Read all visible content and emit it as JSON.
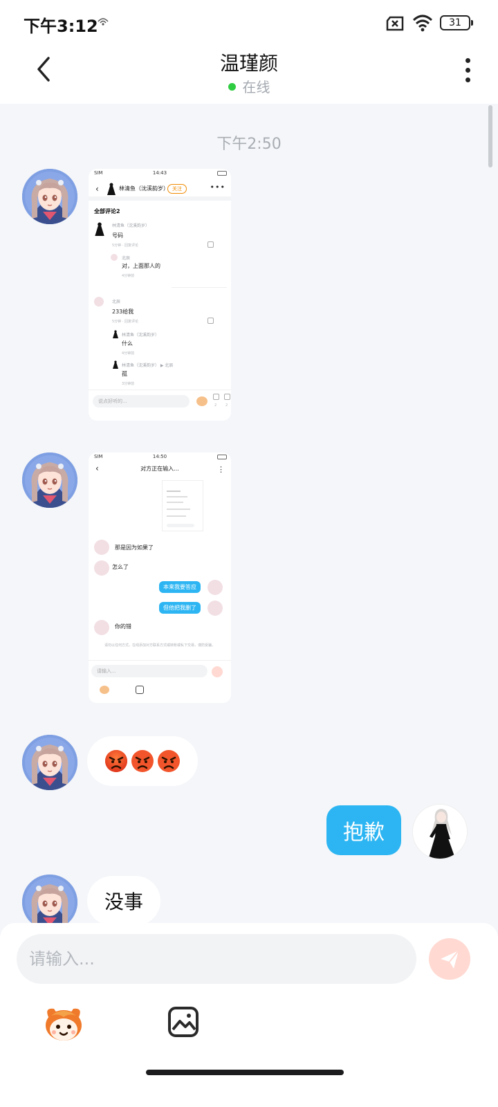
{
  "status_bar": {
    "time": "下午3:12",
    "battery": "31"
  },
  "header": {
    "title": "温瑾颜",
    "status": "在线"
  },
  "timestamp": "下午2:50",
  "messages": {
    "shot1": {
      "time": "14:43",
      "carrier": "SIM",
      "user_name": "林清鱼（沈溪韵岁）",
      "follow_label": "关注",
      "section": "全部评论2",
      "c1_name": "林清鱼（沈溪韵岁）",
      "c1_text": "号码",
      "c1_meta": "5分钟 · 回复评论",
      "r1_name": "北辰",
      "r1_text": "对，上面那人的",
      "r1_meta": "4分钟前",
      "c2_name": "北辰",
      "c2_text": "233给我",
      "c2_meta": "5分钟 · 回复评论",
      "r2_name": "林清鱼（沈溪韵岁）",
      "r2_text": "什么",
      "r2_meta": "4分钟前",
      "r3_name": "林清鱼（沈溪韵岁） ▶ 北辰",
      "r3_text": "孤",
      "r3_meta": "3分钟前",
      "input_placeholder": "说点好听的...",
      "count1": "2",
      "count2": "2"
    },
    "shot2": {
      "time": "14:50",
      "carrier": "SIM",
      "title": "对方正在输入...",
      "m1": "那是因为如果了",
      "m2": "怎么了",
      "m3": "本来我要答应",
      "m4": "但他把我删了",
      "m5": "你的错",
      "notice": "请勿以任何方式，在线添加对方联系方式或转账或私下交易，谨防受骗。",
      "input_placeholder": "请输入..."
    },
    "emoji_message": [
      "angry",
      "angry",
      "angry"
    ],
    "sent_text": "抱歉",
    "reply_text": "没事"
  },
  "composer": {
    "placeholder": "请输入..."
  },
  "icons": {
    "back": "chevron-left-icon",
    "more": "more-vertical-icon",
    "send": "send-icon",
    "emoji": "emoji-icon",
    "image": "image-icon"
  },
  "colors": {
    "accent": "#2cb5f2",
    "online": "#2ecc40",
    "send_btn": "#ffd9d2"
  }
}
